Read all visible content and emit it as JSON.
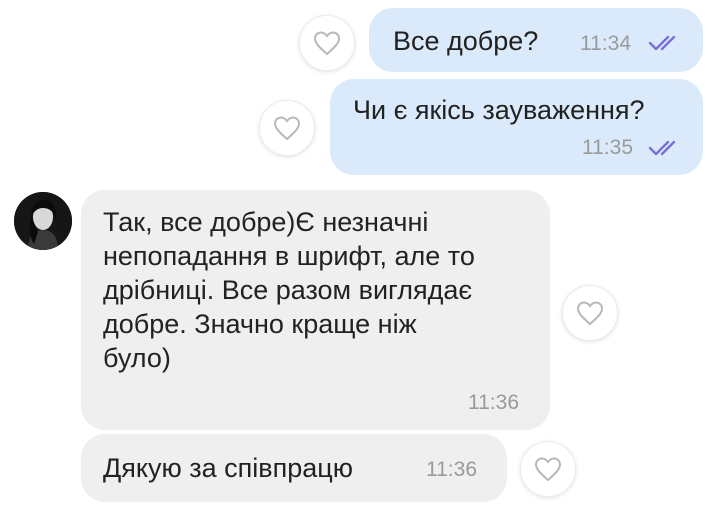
{
  "messages": [
    {
      "direction": "outgoing",
      "text": "Все добре?",
      "time": "11:34",
      "status": "read",
      "read_color": "#7b6fd6"
    },
    {
      "direction": "outgoing",
      "text": "Чи є якісь зауваження?",
      "time": "11:35",
      "status": "read",
      "read_color": "#7b6fd6"
    },
    {
      "direction": "incoming",
      "text": "Так, все добре)Є незначні\nнепопадання в шрифт, але то\nдрібниці. Все разом виглядає\nдобре. Значно краще ніж\nбуло)",
      "time": "11:36"
    },
    {
      "direction": "incoming",
      "text": "Дякую за співпрацю",
      "time": "11:36"
    }
  ],
  "colors": {
    "outgoing_bubble": "#dbeafb",
    "incoming_bubble": "#efefef",
    "read_ticks": "#7b6fd6"
  },
  "icons": {
    "like": "heart-outline-icon",
    "read_receipt": "double-check-icon",
    "sender_avatar": "avatar"
  }
}
